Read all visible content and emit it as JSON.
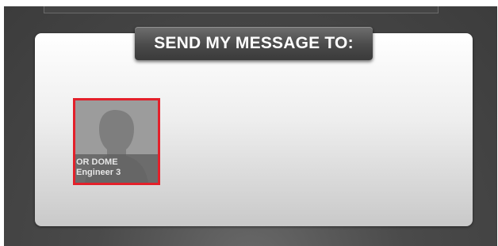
{
  "header": {
    "title": "SEND MY MESSAGE TO:"
  },
  "recipients": [
    {
      "name": "OR DOME",
      "role": "Engineer 3",
      "selected": true,
      "avatar_icon": "person-silhouette-icon"
    }
  ],
  "colors": {
    "selection_border": "#e3202a",
    "background": "#444444",
    "panel": "#f0f0f0",
    "header_tab": "#4a4a4a"
  }
}
